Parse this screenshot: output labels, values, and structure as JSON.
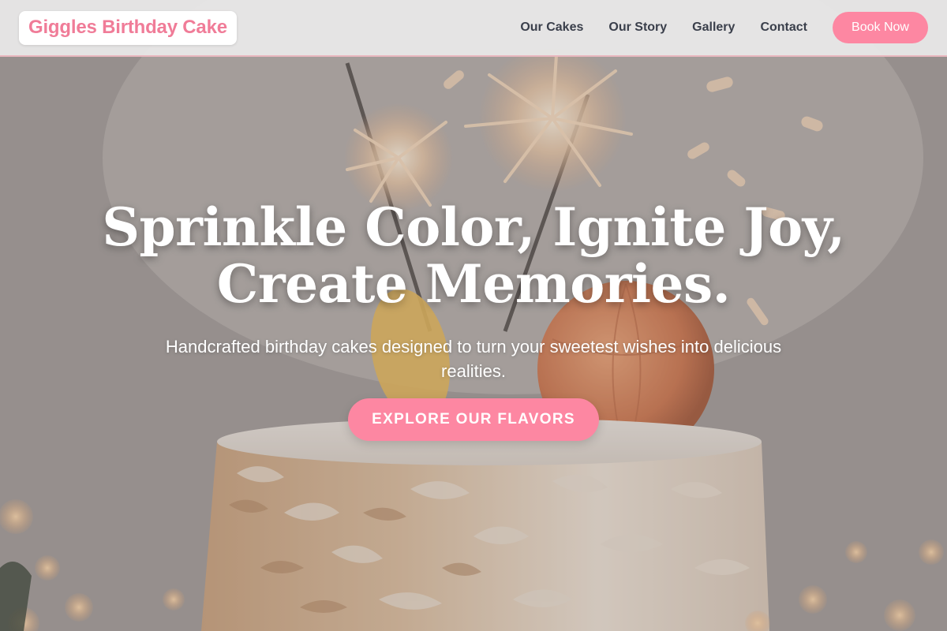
{
  "header": {
    "brand": "Giggles Birthday Cake",
    "nav": [
      {
        "label": "Our Cakes"
      },
      {
        "label": "Our Story"
      },
      {
        "label": "Gallery"
      },
      {
        "label": "Contact"
      }
    ],
    "cta_label": "Book Now"
  },
  "hero": {
    "headline_line1": "Sprinkle Color, Ignite Joy,",
    "headline_line2": "Create Memories.",
    "subheadline": "Handcrafted birthday cakes designed to turn your sweetest wishes into delicious realities.",
    "cta_label": "EXPLORE OUR FLAVORS"
  },
  "colors": {
    "accent": "#fd87a2",
    "brand_text": "#f07c98",
    "nav_text": "#3a3f4b",
    "header_bg": "#e8e7e7"
  },
  "icons": []
}
